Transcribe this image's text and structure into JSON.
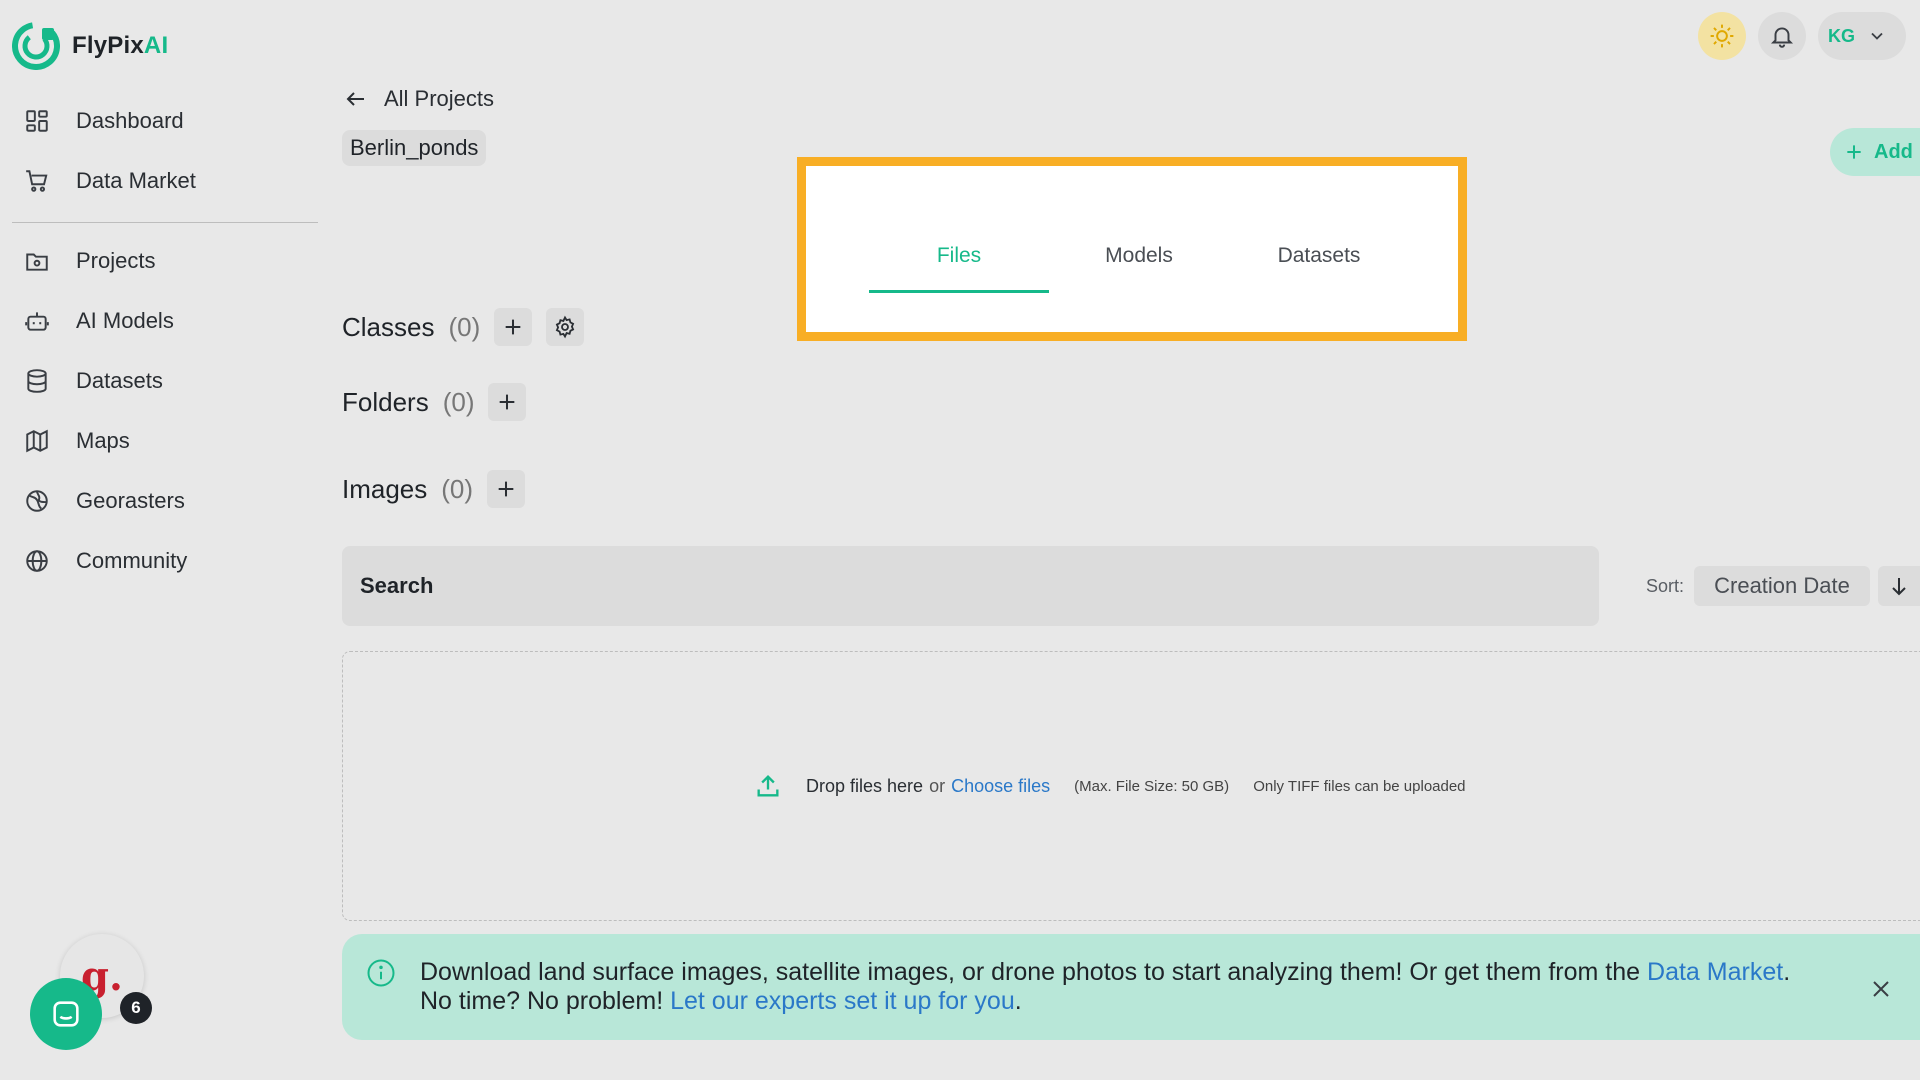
{
  "brand": {
    "name_main": "FlyPix",
    "name_accent": "AI"
  },
  "sidebar": {
    "items": [
      {
        "label": "Dashboard",
        "icon": "dashboard-icon"
      },
      {
        "label": "Data Market",
        "icon": "cart-icon"
      },
      {
        "label": "Projects",
        "icon": "folder-icon"
      },
      {
        "label": "AI Models",
        "icon": "robot-icon"
      },
      {
        "label": "Datasets",
        "icon": "database-icon"
      },
      {
        "label": "Maps",
        "icon": "map-icon"
      },
      {
        "label": "Georasters",
        "icon": "globe-grid-icon"
      },
      {
        "label": "Community",
        "icon": "globe-icon"
      }
    ]
  },
  "header": {
    "user_initials": "KG"
  },
  "back": {
    "label": "All Projects"
  },
  "project": {
    "name": "Berlin_ponds"
  },
  "add_button": {
    "label": "Add"
  },
  "tabs": [
    {
      "label": "Files",
      "active": true
    },
    {
      "label": "Models",
      "active": false
    },
    {
      "label": "Datasets",
      "active": false
    }
  ],
  "sections": {
    "classes": {
      "label": "Classes",
      "count": "(0)"
    },
    "folders": {
      "label": "Folders",
      "count": "(0)"
    },
    "images": {
      "label": "Images",
      "count": "(0)"
    }
  },
  "search": {
    "placeholder": "Search"
  },
  "sort": {
    "label": "Sort:",
    "value": "Creation Date"
  },
  "dropzone": {
    "drop_text": "Drop files here",
    "or": "or",
    "choose": "Choose files",
    "max_size": "(Max. File Size: 50 GB)",
    "only_tiff": "Only TIFF files can be uploaded"
  },
  "banner": {
    "line1": "Download land surface images, satellite images, or drone photos to start analyzing them! Or get them from the ",
    "link1": "Data Market",
    "period1": ".",
    "line2": "No time? No problem! ",
    "link2": "Let our experts set it up for you",
    "period2": "."
  },
  "chat": {
    "badge_letter": "g.",
    "count": "6"
  },
  "colors": {
    "accent": "#16b98a",
    "highlight": "#f8ae25",
    "link": "#2a78c8"
  }
}
